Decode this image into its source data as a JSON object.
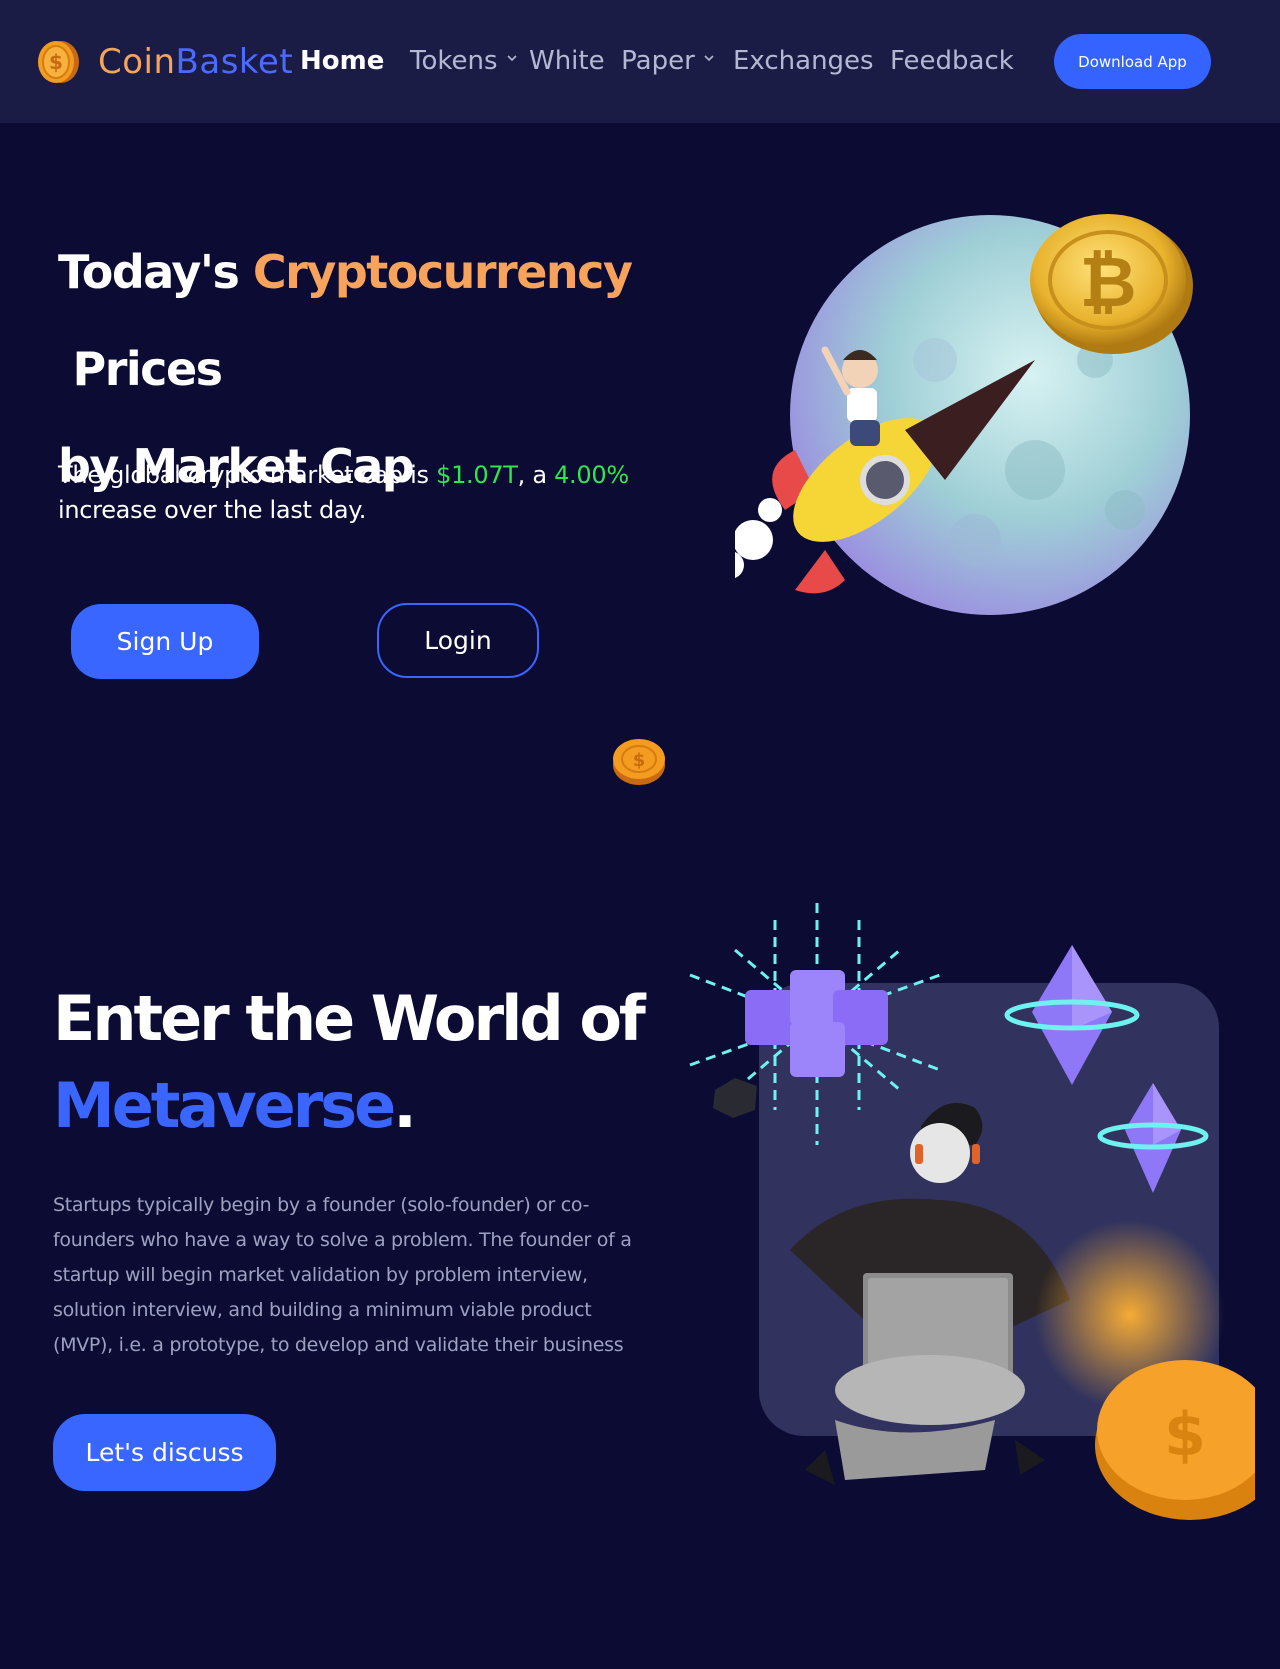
{
  "nav": {
    "brand_part1": "Coin",
    "brand_part2": "Basket",
    "links": [
      {
        "label": "Home",
        "active": true,
        "dropdown": false
      },
      {
        "label": "Tokens",
        "active": false,
        "dropdown": true
      },
      {
        "label": "White  Paper",
        "active": false,
        "dropdown": true
      },
      {
        "label": "Exchanges",
        "active": false,
        "dropdown": false
      },
      {
        "label": "Feedback",
        "active": false,
        "dropdown": false
      }
    ],
    "download_label": "Download App"
  },
  "hero": {
    "title_part1": "Today's ",
    "title_accent": "Cryptocurrency",
    "title_part2": " Prices",
    "title_line2": "by Market Cap",
    "desc_prefix": "The global crypto market cap is ",
    "market_cap": "$1.07T",
    "desc_mid": ", a ",
    "change": "4.00%",
    "desc_suffix": "increase over the last day.",
    "signup_label": "Sign Up",
    "login_label": "Login"
  },
  "metaverse": {
    "title_line1": "Enter the World of",
    "title_accent": "Metaverse",
    "title_dot": ".",
    "description": "Startups typically begin by a founder (solo-founder) or co-founders who have a way to solve a problem. The founder of a startup will begin market validation by problem interview, solution interview, and building a minimum viable product (MVP), i.e. a prototype, to develop and validate their business",
    "cta_label": "Let's discuss"
  },
  "colors": {
    "background": "#0b0b33",
    "nav_background": "#1b1c45",
    "primary_blue": "#3866ff",
    "accent_orange": "#f7a35c",
    "positive_green": "#2ee84a"
  }
}
